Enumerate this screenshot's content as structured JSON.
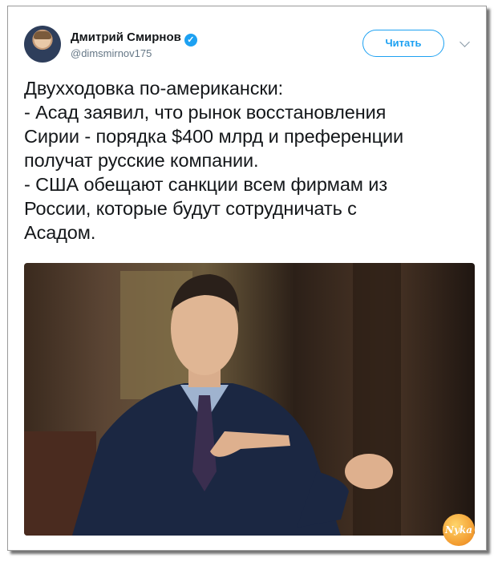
{
  "author": {
    "name": "Дмитрий Смирнов",
    "handle": "@dimsmirnov175",
    "verified_icon": "verified-badge-icon"
  },
  "header": {
    "follow_label": "Читать",
    "menu_icon": "chevron-down-icon"
  },
  "tweet": {
    "text": "Двухходовка по-американски:\n- Асад заявил, что рынок восстановления\nСирии - порядка $400 млрд и преференции\nполучат русские компании.\n- США обещают санкции всем фирмам из\nРоссии, которые будут сотрудничать с\nАсадом."
  },
  "media": {
    "watermark": "Nyka"
  },
  "colors": {
    "accent": "#1da1f2",
    "text": "#14171a",
    "muted": "#657786"
  }
}
